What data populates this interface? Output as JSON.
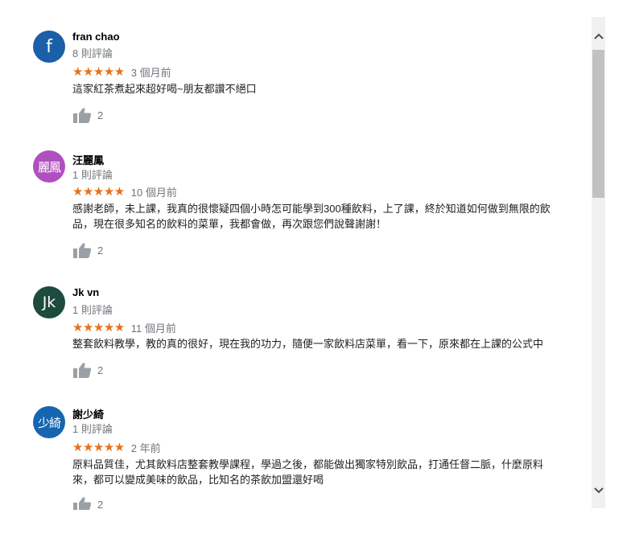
{
  "reviews": [
    {
      "author": "fran chao",
      "review_count": "8 則評論",
      "stars": "★★★★★",
      "rating": 5,
      "date": "3 個月前",
      "text_lines": [
        "這家紅茶煮起來超好喝~朋友都讚不絕口"
      ],
      "likes": "2",
      "avatar_text": "f",
      "avatar_color": "#1a5fa8",
      "thumb_icon": "thumb-up-icon"
    },
    {
      "author": "汪麗鳳",
      "review_count": "1 則評論",
      "stars": "★★★★★",
      "rating": 5,
      "date": "10 個月前",
      "text_lines": [
        "感謝老師，未上課，我真的很懷疑四個小時怎可能學到300種飲料，上了課，終於知道如何做到無限的飲",
        "品，現在很多知名的飲料的菜單，我都會做，再次跟您們說聲謝謝！"
      ],
      "likes": "2",
      "avatar_text": "麗鳳",
      "avatar_color": "#b04fbf",
      "thumb_icon": "thumb-up-icon"
    },
    {
      "author": "Jk vn",
      "review_count": "1 則評論",
      "stars": "★★★★★",
      "rating": 5,
      "date": "11 個月前",
      "text_lines": [
        "整套飲料教學，教的真的很好，現在我的功力，隨便一家飲料店菜單，看一下，原來都在上課的公式中"
      ],
      "likes": "2",
      "avatar_text": "Jk",
      "avatar_color": "#1d4b3e",
      "thumb_icon": "thumb-up-icon"
    },
    {
      "author": "謝少綺",
      "review_count": "1 則評論",
      "stars": "★★★★★",
      "rating": 5,
      "date": "2 年前",
      "text_lines": [
        "原料品質佳，尤其飲料店整套教學課程，學過之後，都能做出獨家特別飲品，打通任督二脈，什麼原料",
        "來，都可以變成美味的飲品，比知名的茶飲加盟還好喝"
      ],
      "likes": "2",
      "avatar_text": "少綺",
      "avatar_color": "#1565b0",
      "thumb_icon": "thumb-up-icon"
    }
  ],
  "colors": {
    "star": "#e7711b",
    "meta_text": "#70757a",
    "thumb": "#9aa0a6"
  },
  "scrollbar": {
    "up_icon": "chevron-up-icon",
    "down_icon": "chevron-down-icon"
  }
}
